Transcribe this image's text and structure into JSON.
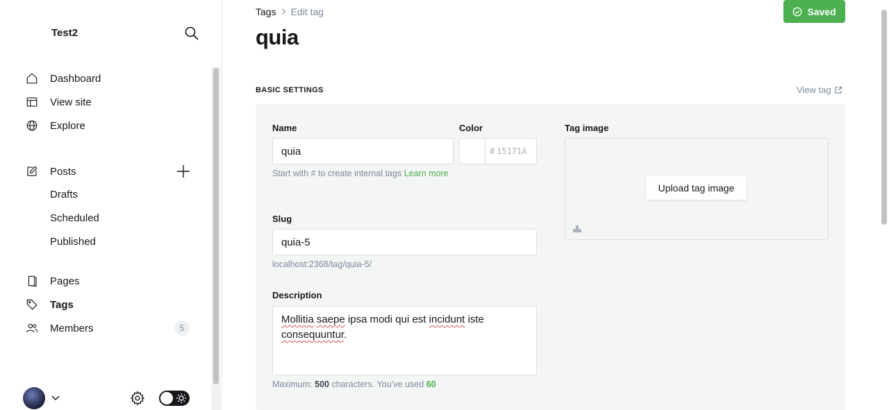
{
  "sidebar": {
    "site_title": "Test2",
    "nav": [
      {
        "label": "Dashboard",
        "icon": "home-icon"
      },
      {
        "label": "View site",
        "icon": "layout-icon"
      },
      {
        "label": "Explore",
        "icon": "globe-icon"
      }
    ],
    "posts": {
      "label": "Posts",
      "sub": [
        "Drafts",
        "Scheduled",
        "Published"
      ]
    },
    "nav2": [
      {
        "label": "Pages",
        "icon": "page-icon"
      },
      {
        "label": "Tags",
        "icon": "tag-icon",
        "active": true
      },
      {
        "label": "Members",
        "icon": "members-icon",
        "badge": "5"
      }
    ]
  },
  "breadcrumb": {
    "parent": "Tags",
    "current": "Edit tag"
  },
  "page_title": "quia",
  "save_button": {
    "label": "Saved",
    "color": "#4caf50"
  },
  "section": {
    "title": "BASIC SETTINGS",
    "view_tag": "View tag"
  },
  "form": {
    "name": {
      "label": "Name",
      "value": "quia"
    },
    "name_hint": "Start with # to create internal tags",
    "name_hint_link": "Learn more",
    "color": {
      "label": "Color",
      "hash": "#",
      "placeholder": "15171A"
    },
    "slug": {
      "label": "Slug",
      "value": "quia-5",
      "url": "localhost:2368/tag/quia-5/"
    },
    "description": {
      "label": "Description",
      "words": [
        "Mollitia",
        "saepe",
        "ipsa modi qui est",
        "incidunt",
        "iste",
        "consequuntur",
        "."
      ],
      "hint_prefix": "Maximum:",
      "max": "500",
      "hint_mid": "characters. You’ve used",
      "used": "60"
    },
    "tag_image": {
      "label": "Tag image",
      "button": "Upload tag image"
    }
  }
}
